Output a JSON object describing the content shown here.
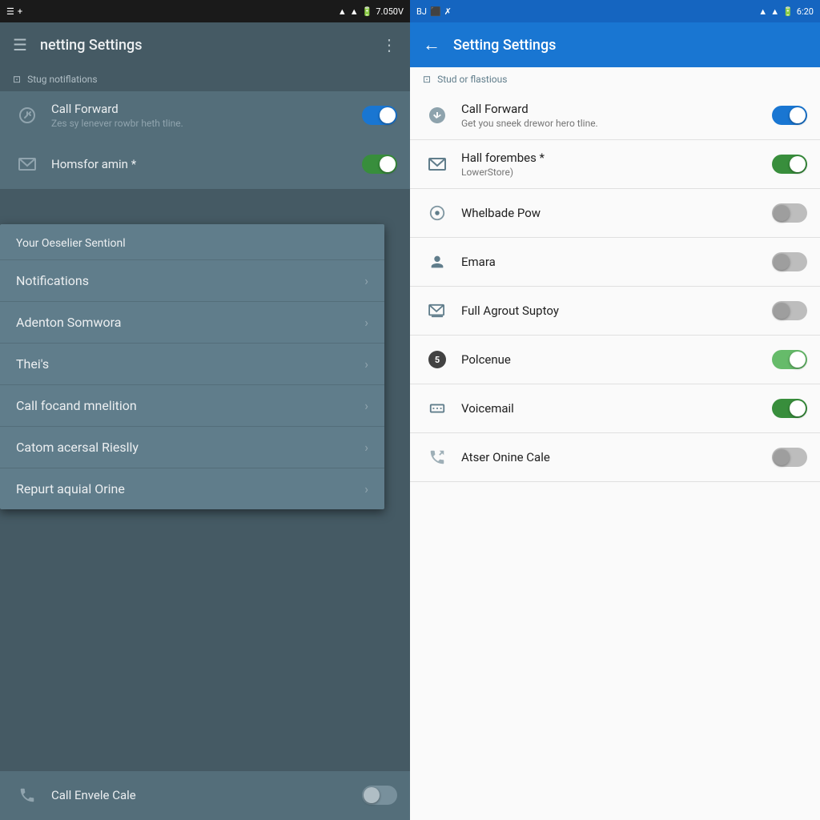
{
  "left": {
    "status_bar": {
      "time": "7.050V",
      "icons": "▲ WiFi signal battery"
    },
    "toolbar": {
      "title": "netting Settings",
      "menu_icon": "⋮"
    },
    "section_header": "Stug notiflations",
    "settings_items": [
      {
        "icon": "call-forward",
        "title": "Call Forward",
        "subtitle": "Zes sy lenever rowbr heth tline.",
        "toggle": "blue"
      },
      {
        "icon": "email",
        "title": "Homsfor amin *",
        "subtitle": "",
        "toggle": "green"
      }
    ],
    "dropdown": {
      "section_title": "Your Oeselier Sentionl",
      "items": [
        {
          "label": "Notifications"
        },
        {
          "label": "Adenton Somwora"
        },
        {
          "label": "Thei's"
        },
        {
          "label": "Call focand mnelition"
        },
        {
          "label": "Catom acersal Rieslly"
        },
        {
          "label": "Repurt aquial Orine"
        }
      ]
    },
    "bottom_item": {
      "icon": "call",
      "title": "Call Envele Cale",
      "toggle": "gray"
    }
  },
  "right": {
    "status_bar": {
      "left_icons": "BJ ⬛ ✗",
      "time": "6:20",
      "right_icons": "WiFi signal battery"
    },
    "toolbar": {
      "title": "Setting Settings",
      "back_label": "←"
    },
    "section_header": "Stud or flastious",
    "settings_items": [
      {
        "icon": "call-forward",
        "title": "Call Forward",
        "subtitle": "Get you sneek drewor hero tline.",
        "toggle": "blue"
      },
      {
        "icon": "email",
        "title": "Hall forembes *",
        "subtitle": "LowerStore)",
        "toggle": "green"
      },
      {
        "icon": "settings",
        "title": "Whelbade Pow",
        "subtitle": "",
        "toggle": "gray"
      },
      {
        "icon": "person",
        "title": "Emara",
        "subtitle": "",
        "toggle": "gray-slider"
      },
      {
        "icon": "email-outline",
        "title": "Full Agrout Suptoy",
        "subtitle": "",
        "toggle": "gray-slider"
      },
      {
        "icon": "badge-5",
        "title": "Polcenue",
        "subtitle": "",
        "toggle": "light-green"
      },
      {
        "icon": "briefcase",
        "title": "Voicemail",
        "subtitle": "",
        "toggle": "green"
      },
      {
        "icon": "call-end",
        "title": "Atser Onine Cale",
        "subtitle": "",
        "toggle": "gray"
      }
    ]
  }
}
